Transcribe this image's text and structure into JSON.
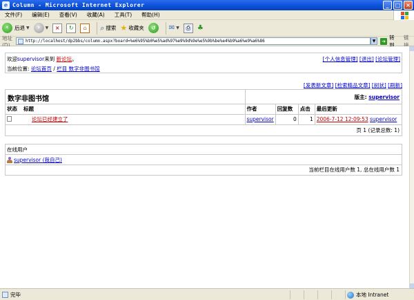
{
  "window": {
    "title": "Column - Microsoft Internet Explorer",
    "min": "_",
    "max": "□",
    "close": "×"
  },
  "menu": [
    "文件(F)",
    "编辑(E)",
    "查看(V)",
    "收藏(A)",
    "工具(T)",
    "帮助(H)"
  ],
  "toolbar": {
    "back": "后退",
    "search": "搜索",
    "favorites": "收藏夹"
  },
  "address": {
    "label": "地址(D)",
    "url": "http://localhost/dp2bbs/column.aspx?board=%e6%95%b0%e5%ad%97%e9%9d%9e%e5%9b%be%e4%b9%a6%e9%a6%86",
    "go": "转到",
    "links": "链接"
  },
  "header": {
    "welcome_prefix": "欢迎",
    "username": "supervisor",
    "welcome_mid": "来到",
    "forum_link": "新论坛",
    "welcome_suffix": "。",
    "location_label": "当前位置:",
    "crumb_home": "论坛首页",
    "crumb_sep": "/",
    "crumb_board": "栏目 数字非图书馆",
    "link_profile": "[个人信息管理]",
    "link_logout": "[退出]",
    "link_admin": "[论坛管理]"
  },
  "board_links": [
    "[发表新文章]",
    "[检索精品文章]",
    "[树状]",
    "[刷新]"
  ],
  "board": {
    "name": "数字非图书馆",
    "moderator_label": "版主:",
    "moderator": "supervisor",
    "columns": [
      "状态",
      "标题",
      "作者",
      "回复数",
      "点击",
      "最后更新"
    ],
    "rows": [
      {
        "title": "论坛已经建立了",
        "author": "supervisor",
        "replies": "0",
        "clicks": "1",
        "updated": "2006-7-12 12:09:53",
        "updated_by": "supervisor"
      }
    ],
    "pager": "页 1 (记录总数: 1)"
  },
  "online": {
    "header": "在线用户",
    "user": "supervisor (我自己)",
    "footer": "当前栏目在线用户数 1, 总在线用户数 1"
  },
  "status": {
    "text": "完毕",
    "zone": "本地 Intranet"
  }
}
